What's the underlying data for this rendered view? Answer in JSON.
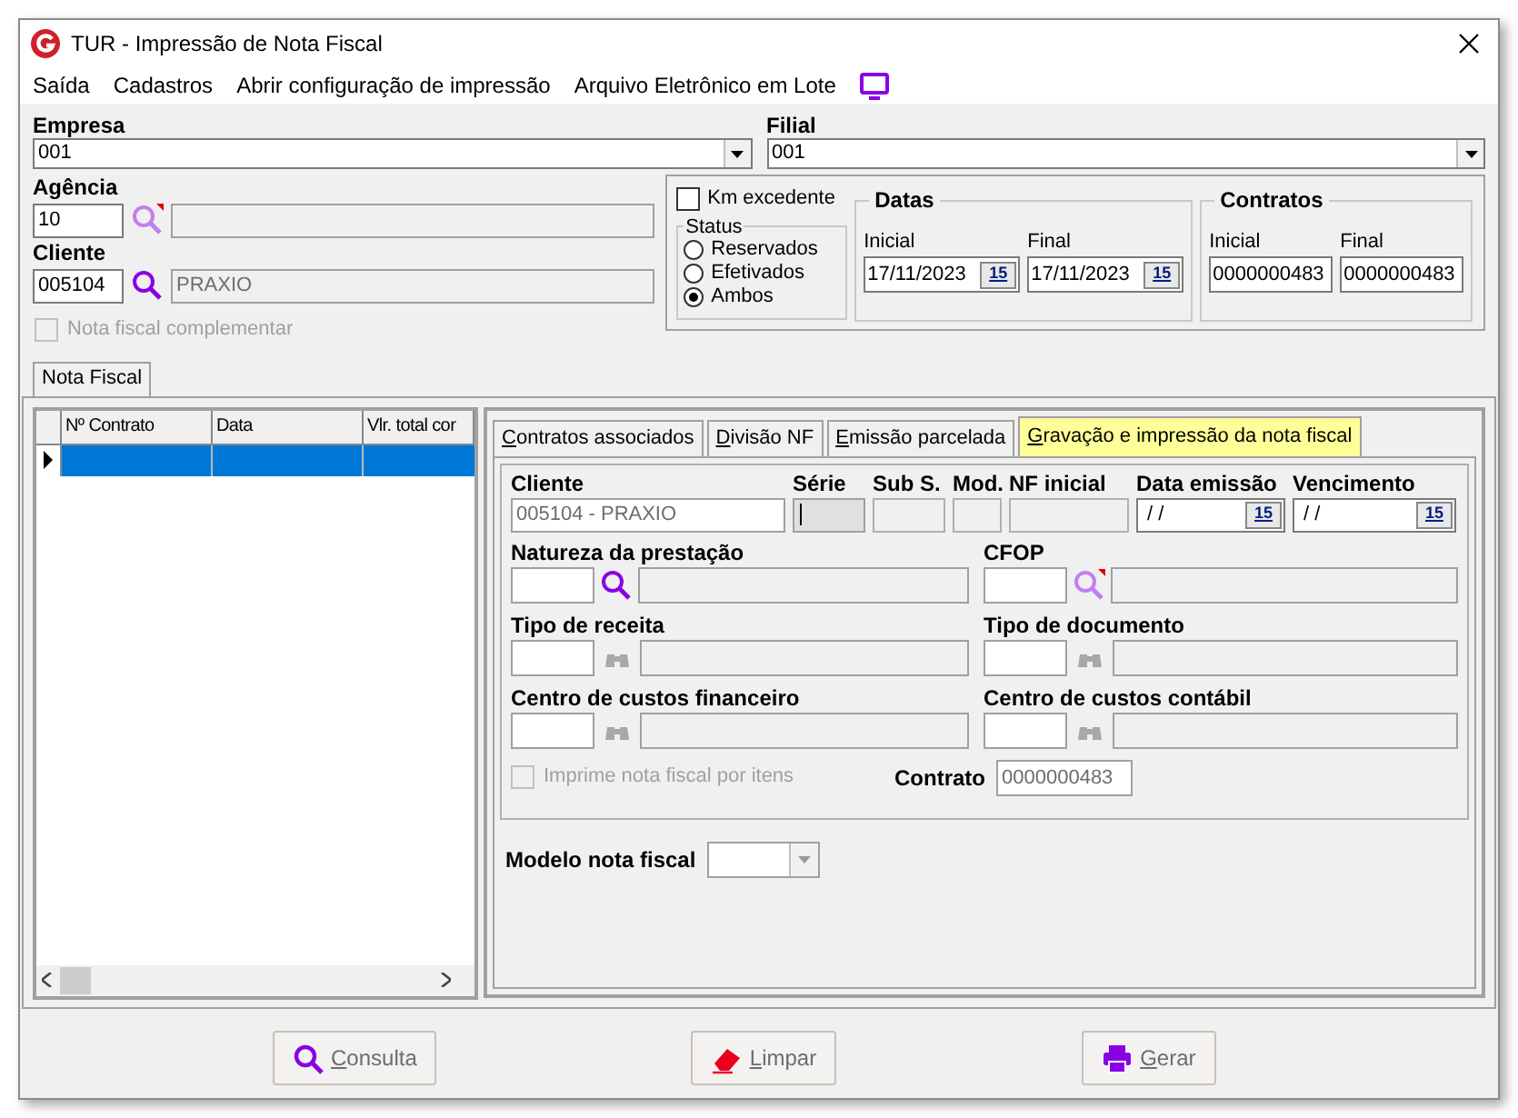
{
  "window": {
    "title": "TUR - Impressão de Nota Fiscal"
  },
  "menu": [
    {
      "label": "Saída"
    },
    {
      "label": "Cadastros"
    },
    {
      "label": "Abrir configuração de impressão"
    },
    {
      "label": "Arquivo Eletrônico em Lote"
    }
  ],
  "empresa": {
    "label": "Empresa",
    "value": "001"
  },
  "filial": {
    "label": "Filial",
    "value": "001"
  },
  "agencia": {
    "label": "Agência",
    "code": "10"
  },
  "cliente": {
    "label": "Cliente",
    "code": "005104",
    "name": "PRAXIO"
  },
  "complementar": {
    "label": "Nota fiscal complementar",
    "checked": false,
    "disabled": true
  },
  "km_excedente": {
    "label": "Km excedente",
    "checked": false
  },
  "status": {
    "title": "Status",
    "options": [
      {
        "label": "Reservados",
        "selected": false
      },
      {
        "label": "Efetivados",
        "selected": false
      },
      {
        "label": "Ambos",
        "selected": true
      }
    ]
  },
  "datas": {
    "title": "Datas",
    "fields": [
      {
        "label": "Inicial",
        "value": "17/11/2023",
        "button": "15"
      },
      {
        "label": "Final",
        "value": "17/11/2023",
        "button": "15"
      }
    ]
  },
  "contratos": {
    "title": "Contratos",
    "fields": [
      {
        "label": "Inicial",
        "value": "0000000483"
      },
      {
        "label": "Final",
        "value": "0000000483"
      }
    ]
  },
  "outer_tabs": [
    {
      "label": "Nota Fiscal",
      "selected": true
    }
  ],
  "grid": {
    "columns": [
      "Nº Contrato",
      "Data",
      "Vlr. total cor"
    ],
    "rows": [
      {
        "selected": true
      }
    ]
  },
  "tabs": [
    {
      "label": "Contratos associados",
      "selected": false
    },
    {
      "label": "Divisão NF",
      "selected": false
    },
    {
      "label": "Emissão parcelada",
      "selected": false
    },
    {
      "label": "Gravação e impressão da nota fiscal",
      "selected": true
    }
  ],
  "form": {
    "top": [
      {
        "label": "Cliente",
        "value": "005104 - PRAXIO",
        "kind": "text"
      },
      {
        "label": "Série",
        "kind": "active"
      },
      {
        "label": "Sub S.",
        "kind": "readonly"
      },
      {
        "label": "Mod.",
        "kind": "readonly"
      },
      {
        "label": "NF inicial",
        "kind": "readonly"
      },
      {
        "label": "Data emissão",
        "value": "/ /",
        "button": "15",
        "kind": "date"
      },
      {
        "label": "Vencimento",
        "value": "/ /",
        "button": "15",
        "kind": "date"
      }
    ],
    "lookups": [
      {
        "label": "Natureza da prestação",
        "kind": "search"
      },
      {
        "label": "CFOP",
        "kind": "search-required"
      },
      {
        "label": "Tipo de receita",
        "kind": "binoculars"
      },
      {
        "label": "Tipo de documento",
        "kind": "binoculars"
      },
      {
        "label": "Centro de custos financeiro",
        "kind": "binoculars"
      },
      {
        "label": "Centro de custos contábil",
        "kind": "binoculars"
      }
    ],
    "imprime": {
      "label": "Imprime nota fiscal por itens",
      "checked": false,
      "disabled": true
    },
    "contrato": {
      "label": "Contrato",
      "value": "0000000483"
    }
  },
  "modelo": {
    "label": "Modelo nota fiscal"
  },
  "buttons": [
    {
      "label": "Consulta",
      "kind": "search"
    },
    {
      "label": "Limpar",
      "kind": "clear"
    },
    {
      "label": "Gerar",
      "kind": "print"
    }
  ]
}
